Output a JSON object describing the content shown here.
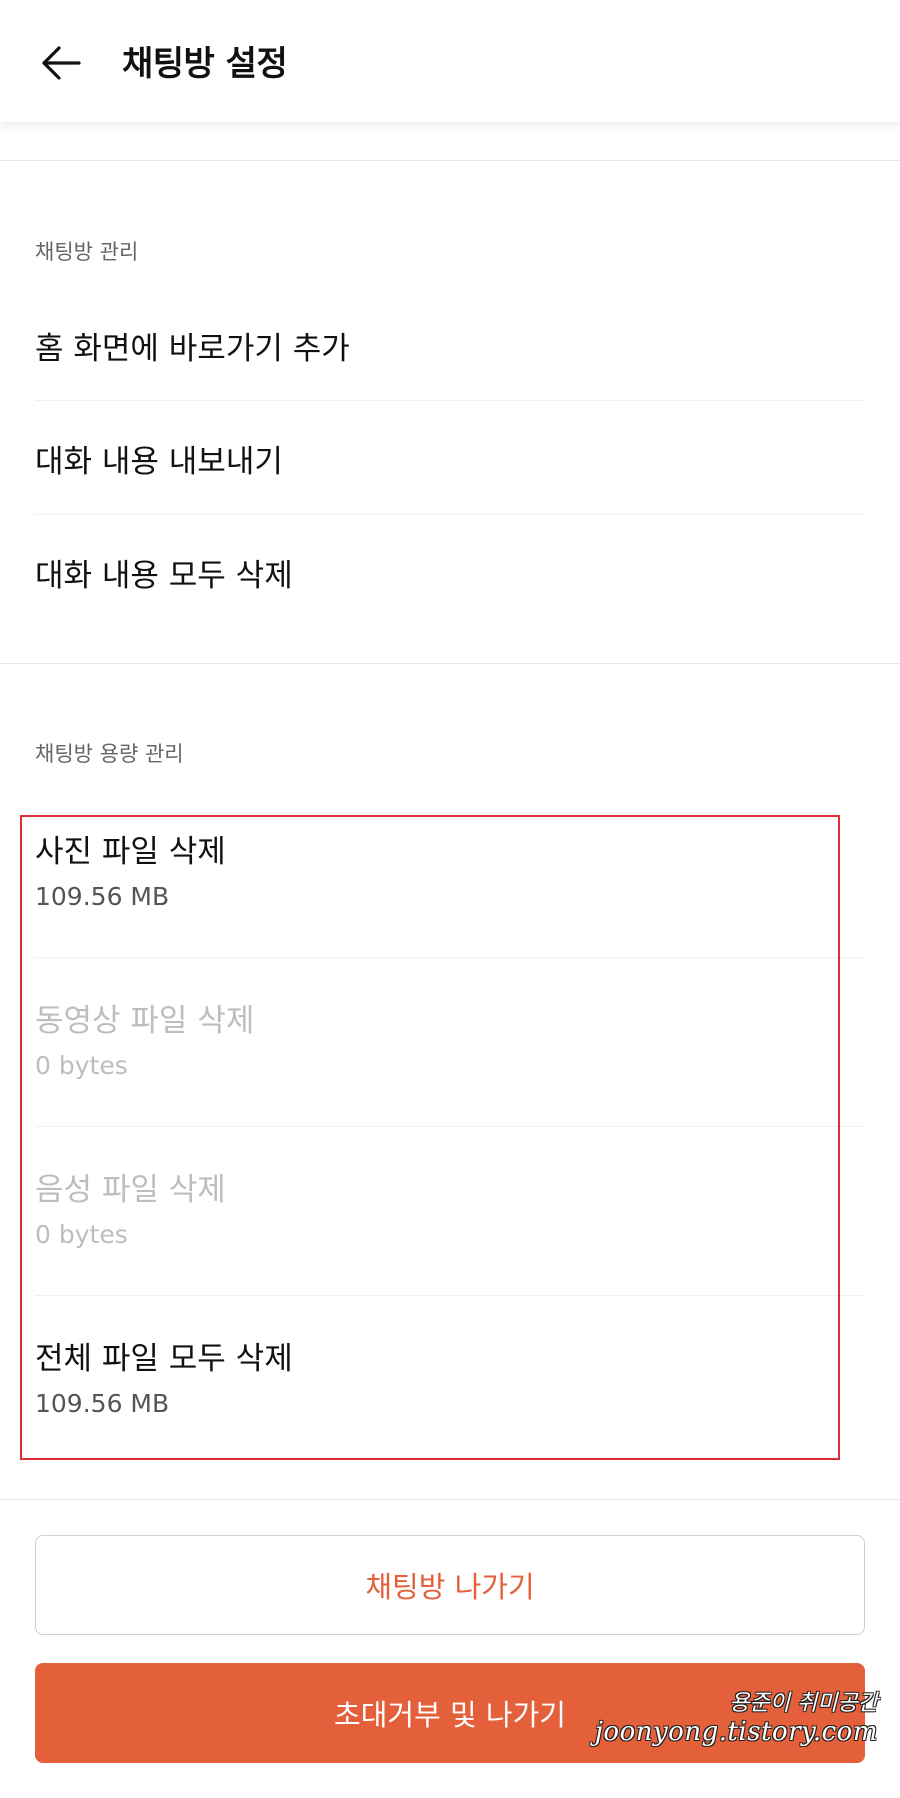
{
  "header": {
    "back_icon": "arrow-left-icon",
    "title": "채팅방 설정"
  },
  "chat_management": {
    "label": "채팅방 관리",
    "items": [
      {
        "label": "홈 화면에 바로가기 추가"
      },
      {
        "label": "대화 내용 내보내기"
      },
      {
        "label": "대화 내용 모두 삭제"
      }
    ]
  },
  "storage_management": {
    "label": "채팅방 용량 관리",
    "items": [
      {
        "title": "사진 파일 삭제",
        "size": "109.56 MB",
        "enabled": true
      },
      {
        "title": "동영상 파일 삭제",
        "size": "0 bytes",
        "enabled": false
      },
      {
        "title": "음성 파일 삭제",
        "size": "0 bytes",
        "enabled": false
      },
      {
        "title": "전체 파일 모두 삭제",
        "size": "109.56 MB",
        "enabled": true
      }
    ]
  },
  "buttons": {
    "leave_label": "채팅방 나가기",
    "block_leave_label": "초대거부 및 나가기"
  },
  "watermark": {
    "line1": "용준이 취미공간",
    "line2": "joonyong.tistory.com"
  },
  "colors": {
    "accent": "#e4603a",
    "highlight_border": "#e02d38",
    "disabled_text": "#bdbdbd"
  }
}
